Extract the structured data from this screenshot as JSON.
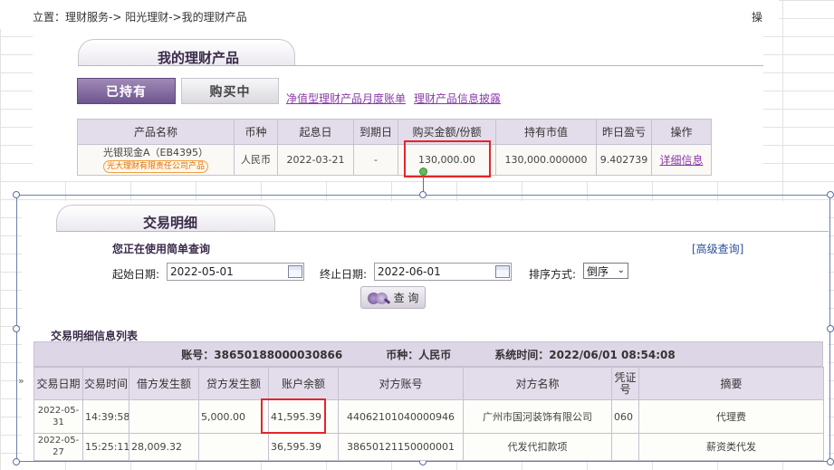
{
  "breadcrumb": {
    "text": "立置：理财服务-> 阳光理财->我的理财产品",
    "right_text": "操"
  },
  "products_panel": {
    "title": "我的理财产品",
    "tab_hold": "已持有",
    "tab_buy": "购买中",
    "link_report": "净值型理财产品月度账单",
    "link_disclosure": "理财产品信息披露",
    "headers": [
      "产品名称",
      "币种",
      "起息日",
      "到期日",
      "购买金额/份额",
      "持有市值",
      "昨日盈亏",
      "操作"
    ],
    "rows": [
      {
        "name": "光银现金A（EB4395）",
        "badge": "光大理财有限责任公司产品",
        "currency": "人民币",
        "start_date": "2022-03-21",
        "end_date": "-",
        "amount": "130,000.00",
        "market_value": "130,000.000000",
        "yesterday_pl": "9.402739",
        "action": "详细信息"
      }
    ]
  },
  "tx_panel": {
    "title": "交易明细",
    "simple_query": "您正在使用简单查询",
    "advanced_query": "[高级查询]",
    "start_label": "起始日期:",
    "start_value": "2022-05-01",
    "end_label": "终止日期:",
    "end_value": "2022-06-01",
    "sort_label": "排序方式:",
    "sort_value": "倒序",
    "query_button": "查 询",
    "list_title": "交易明细信息列表",
    "account": "账号：38650188000030866",
    "currency": "币种：人民币",
    "system_time": "系统时间：2022/06/01 08:54:08",
    "side_marker": "»",
    "headers": [
      "交易日期",
      "交易时间",
      "借方发生额",
      "贷方发生额",
      "账户余额",
      "对方账号",
      "对方名称",
      "凭证号",
      "摘要"
    ],
    "rows": [
      {
        "date_a": "2022-05-",
        "date_b": "31",
        "time": "14:39:58",
        "debit": "",
        "credit": "5,000.00",
        "balance": "41,595.39",
        "counter_account": "44062101040000946",
        "counter_name": "广州市国河装饰有限公司",
        "voucher": "060",
        "summary": "代理费"
      },
      {
        "date_a": "2022-05-",
        "date_b": "27",
        "time": "15:25:11",
        "debit": "28,009.32",
        "credit": "",
        "balance": "36,595.39",
        "counter_account": "38650121150000001",
        "counter_name": "代发代扣款项",
        "voucher": "",
        "summary": "薪资类代发"
      }
    ]
  },
  "colors": {
    "accent": "#7a5f9c",
    "link": "#8a3aa8",
    "highlight": "#e4252b",
    "header_bg": "#e3ddeb"
  }
}
